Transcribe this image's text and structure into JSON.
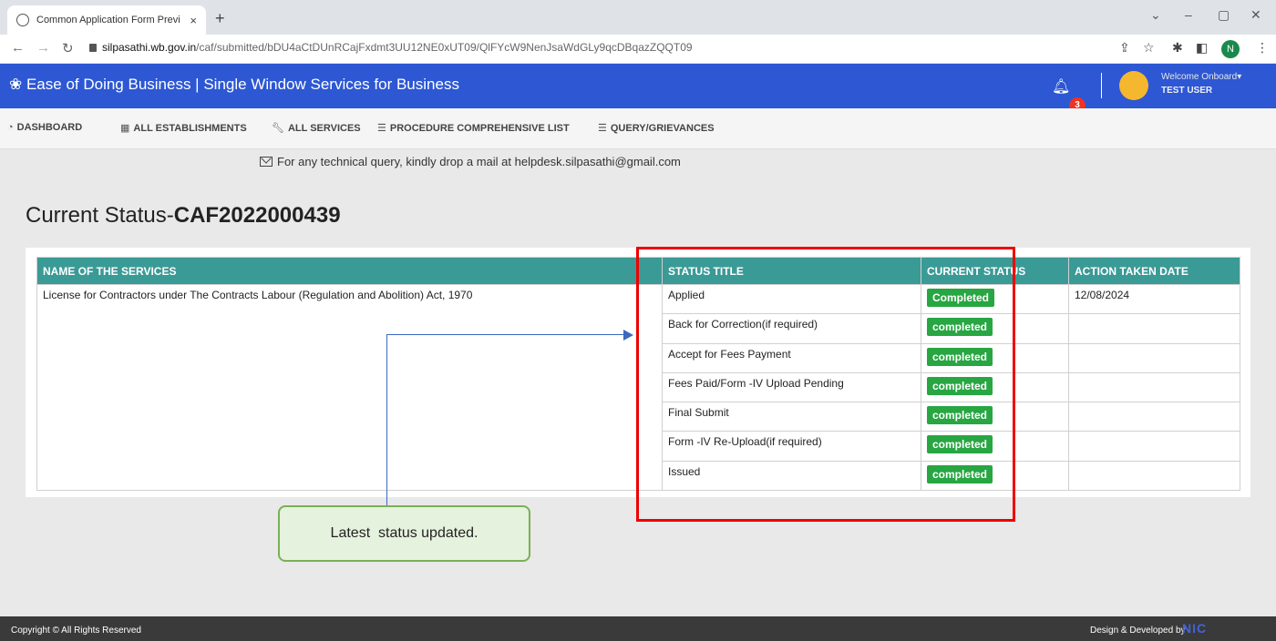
{
  "browser": {
    "tab_title": "Common Application Form Previ",
    "tab_close": "×",
    "new_tab": "+",
    "url_host": "silpasathi.wb.gov.in",
    "url_path": "/caf/submitted/bDU4aCtDUnRCajFxdmt3UU12NE0xUT09/QlFYcW9NenJsaWdGLy9qcDBqazZQQT09",
    "profile_initial": "N"
  },
  "header": {
    "brand": "Ease of Doing Business | Single Window Services for Business",
    "notification_count": "3",
    "welcome": "Welcome Onboard",
    "user_name": "TEST USER"
  },
  "menu": {
    "items": [
      {
        "label": "DASHBOARD"
      },
      {
        "label": "ALL ESTABLISHMENTS"
      },
      {
        "label": "ALL SERVICES"
      },
      {
        "label": "PROCEDURE COMPREHENSIVE LIST"
      },
      {
        "label": "QUERY/GRIEVANCES"
      }
    ]
  },
  "helpline": "For any technical query, kindly drop a mail at helpdesk.silpasathi@gmail.com",
  "page": {
    "title_prefix": "Current Status-",
    "title_id": "CAF2022000439"
  },
  "table": {
    "headers": [
      "NAME OF THE SERVICES",
      "STATUS TITLE",
      "CURRENT STATUS",
      "ACTION TAKEN DATE"
    ],
    "service_name": "License for Contractors under The Contracts Labour (Regulation and Abolition) Act, 1970",
    "rows": [
      {
        "title": "Applied",
        "status": "Completed",
        "date": "12/08/2024"
      },
      {
        "title": "Back for Correction(if required)",
        "status": "completed",
        "date": ""
      },
      {
        "title": "Accept for Fees Payment",
        "status": "completed",
        "date": ""
      },
      {
        "title": "Fees Paid/Form -IV Upload Pending",
        "status": "completed",
        "date": ""
      },
      {
        "title": "Final Submit",
        "status": "completed",
        "date": ""
      },
      {
        "title": "Form -IV Re-Upload(if required)",
        "status": "completed",
        "date": ""
      },
      {
        "title": "Issued",
        "status": "completed",
        "date": ""
      }
    ]
  },
  "annotation": {
    "callout_text": "Latest  status updated."
  },
  "footer": {
    "copyright": "Copyright © All Rights Reserved",
    "developed_by": "Design & Developed by",
    "developer": "NIC"
  },
  "colors": {
    "appbar": "#2d57d3",
    "table_header": "#3a9a96",
    "status_green": "#27a642",
    "highlight_red": "#ee0000"
  }
}
